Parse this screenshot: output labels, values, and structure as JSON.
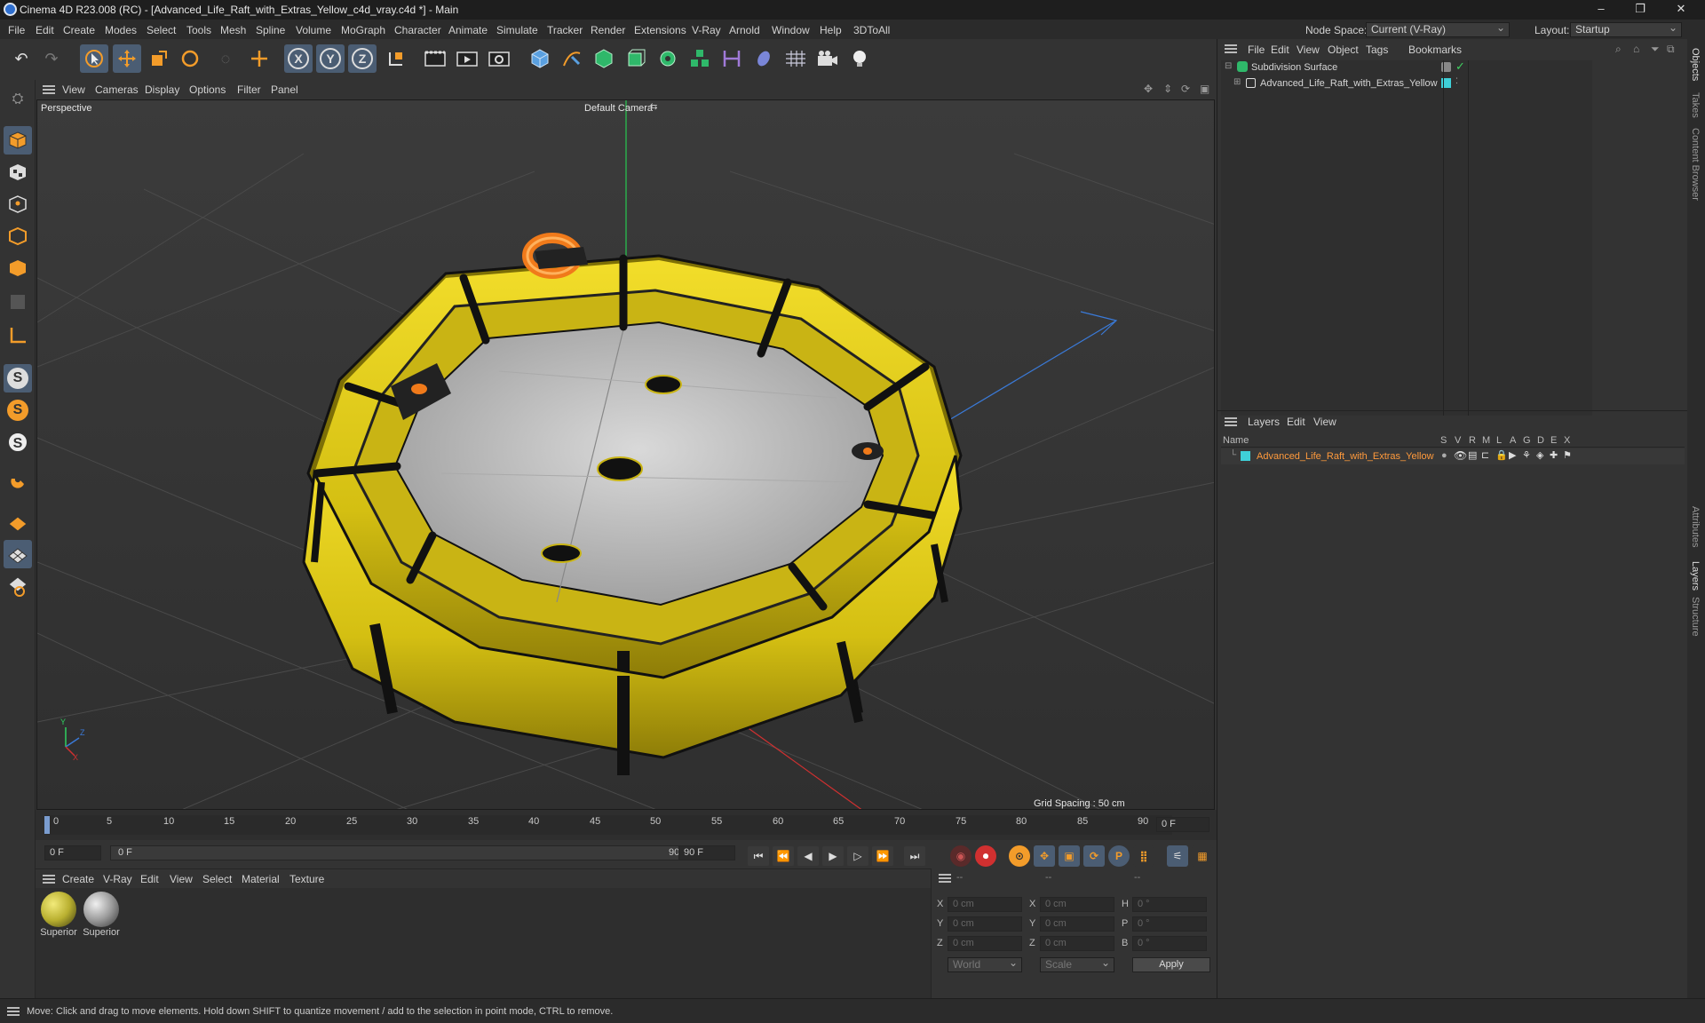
{
  "app": {
    "title": "Cinema 4D R23.008 (RC) - [Advanced_Life_Raft_with_Extras_Yellow_c4d_vray.c4d *] - Main",
    "window_controls": [
      "–",
      "❐",
      "✕"
    ]
  },
  "menubar": {
    "items": [
      "File",
      "Edit",
      "Create",
      "Modes",
      "Select",
      "Tools",
      "Mesh",
      "Spline",
      "Volume",
      "MoGraph",
      "Character",
      "Animate",
      "Simulate",
      "Tracker",
      "Render",
      "Extensions",
      "V-Ray",
      "Arnold",
      "Window",
      "Help",
      "3DToAll"
    ],
    "node_space_label": "Node Space:",
    "node_space_value": "Current (V-Ray)",
    "layout_label": "Layout:",
    "layout_value": "Startup"
  },
  "toolbar": {
    "axis_x": "X",
    "axis_y": "Y",
    "axis_z": "Z"
  },
  "viewport": {
    "menu": [
      "View",
      "Cameras",
      "Display",
      "Options",
      "Filter",
      "Panel"
    ],
    "label": "Perspective",
    "camera": "Default Camera",
    "grid_spacing": "Grid Spacing : 50 cm",
    "axis_y": "Y",
    "axis_z": "Z",
    "axis_x": "X"
  },
  "timeline": {
    "ticks": [
      "0",
      "5",
      "10",
      "15",
      "20",
      "25",
      "30",
      "35",
      "40",
      "45",
      "50",
      "55",
      "60",
      "65",
      "70",
      "75",
      "80",
      "85",
      "90"
    ],
    "current_frame": "0 F"
  },
  "playback": {
    "start": "0 F",
    "range_start": "0 F",
    "range_end": "90 F",
    "end": "90 F"
  },
  "materials": {
    "menu": [
      "Create",
      "V-Ray",
      "Edit",
      "View",
      "Select",
      "Material",
      "Texture"
    ],
    "items": [
      {
        "name": "Superior",
        "color": "#b9b030"
      },
      {
        "name": "Superior",
        "color": "#9a9a9a"
      }
    ]
  },
  "attributes": {
    "headers": [
      "--",
      "--",
      "--"
    ],
    "rows": [
      {
        "l1": "X",
        "v1": "0 cm",
        "l2": "X",
        "v2": "0 cm",
        "l3": "H",
        "v3": "0 °"
      },
      {
        "l1": "Y",
        "v1": "0 cm",
        "l2": "Y",
        "v2": "0 cm",
        "l3": "P",
        "v3": "0 °"
      },
      {
        "l1": "Z",
        "v1": "0 cm",
        "l2": "Z",
        "v2": "0 cm",
        "l3": "B",
        "v3": "0 °"
      }
    ],
    "coord_mode": "World",
    "size_mode": "Scale",
    "apply": "Apply"
  },
  "objects": {
    "menu": [
      "File",
      "Edit",
      "View",
      "Object",
      "Tags",
      "Bookmarks"
    ],
    "items": [
      {
        "name": "Subdivision Surface"
      },
      {
        "name": "Advanced_Life_Raft_with_Extras_Yellow"
      }
    ]
  },
  "layers": {
    "menu": [
      "Layers",
      "Edit",
      "View"
    ],
    "columns": [
      "Name",
      "S",
      "V",
      "R",
      "M",
      "L",
      "A",
      "G",
      "D",
      "E",
      "X"
    ],
    "items": [
      {
        "name": "Advanced_Life_Raft_with_Extras_Yellow",
        "color": "#3fd0d8"
      }
    ]
  },
  "sidetabs": [
    "Objects",
    "Takes",
    "Content Browser",
    "Attributes",
    "Layers",
    "Structure"
  ],
  "status": "Move: Click and drag to move elements. Hold down SHIFT to quantize movement / add to the selection in point mode, CTRL to remove.",
  "colors": {
    "accent": "#4b5d73",
    "raft": "#d8c418",
    "layer_name": "#ff9a3c"
  }
}
